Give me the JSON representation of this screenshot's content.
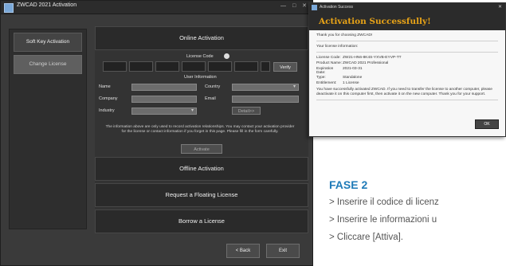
{
  "main_window": {
    "title": "ZWCAD 2021 Activation",
    "controls": "— □ ✕",
    "sidebar": [
      {
        "label": "Soft Key Activation",
        "selected": false
      },
      {
        "label": "Change License",
        "selected": true
      }
    ],
    "online": {
      "header": "Online Activation",
      "license_code_label": "License Code",
      "verify": "Verify",
      "user_info_label": "User Information",
      "name_label": "Name",
      "country_label": "Country",
      "country_value": "",
      "company_label": "Company",
      "email_label": "Email",
      "industry_label": "Industry",
      "industry_value": "",
      "detail_button": "Detail>>",
      "description": "The information above are only used to record activation relationships. You may contact your activation provider for the license or contact information if you forget in this page. Please fill in the form carefully.",
      "activate": "Activate"
    },
    "sections": [
      "Offline Activation",
      "Request a Floating License",
      "Borrow a License"
    ],
    "back": "< Back",
    "exit": "Exit"
  },
  "dialog": {
    "title": "Activation Success",
    "close": "✕",
    "headline": "Activation Successfully!",
    "thanks": "Thank you for choosing ZWCAD!",
    "info_title": "Your license information:",
    "rows": [
      {
        "key": "License Code:",
        "value": "ZW21-HN6-8K4S-YXVB-EYVP-TT"
      },
      {
        "key": "Product Name:",
        "value": "ZWCAD 2021 Professional"
      },
      {
        "key": "Expiration Date:",
        "value": "2021-03-31"
      },
      {
        "key": "Type:",
        "value": "Standalone"
      },
      {
        "key": "Entitlement:",
        "value": "1 License"
      }
    ],
    "note": "You have successfully activated ZWCAD. If you need to transfer the license to another computer, please deactivate it on this computer first, then activate it on the new computer. Thank you for your support.",
    "ok": "OK"
  },
  "caption": {
    "phase": "FASE 2",
    "steps": [
      "> Inserire il codice di licenz",
      "> Inserire le informazioni u",
      "> Cliccare [Attiva]."
    ]
  },
  "colors": {
    "phase_blue": "#1f7bb8",
    "headline_orange": "#e8a317"
  }
}
